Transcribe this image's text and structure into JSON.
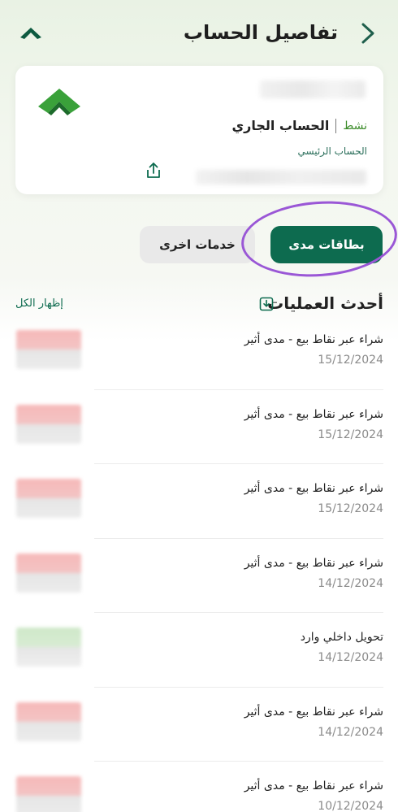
{
  "header": {
    "title": "تفاصيل الحساب",
    "back_icon": "chevron-right-icon",
    "brand_icon": "bank-logo-icon"
  },
  "account": {
    "type": "الحساب الجاري",
    "status": "نشط",
    "subtitle": "الحساب الرئيسي",
    "share_icon": "share-icon"
  },
  "actions": {
    "mada_cards": "بطاقات مدى",
    "other_services": "خدمات اخرى"
  },
  "transactions_section": {
    "title": "أحدث العمليات",
    "show_all": "إظهار الكل",
    "download_icon": "download-icon"
  },
  "transactions": [
    {
      "description": "شراء عبر نقاط بيع - مدى أثير",
      "date": "15/12/2024",
      "direction": "debit"
    },
    {
      "description": "شراء عبر نقاط بيع - مدى أثير",
      "date": "15/12/2024",
      "direction": "debit"
    },
    {
      "description": "شراء عبر نقاط بيع - مدى أثير",
      "date": "15/12/2024",
      "direction": "debit"
    },
    {
      "description": "شراء عبر نقاط بيع - مدى أثير",
      "date": "14/12/2024",
      "direction": "debit"
    },
    {
      "description": "تحويل داخلي وارد",
      "date": "14/12/2024",
      "direction": "credit"
    },
    {
      "description": "شراء عبر نقاط بيع - مدى أثير",
      "date": "14/12/2024",
      "direction": "debit"
    },
    {
      "description": "شراء عبر نقاط بيع - مدى أثير",
      "date": "10/12/2024",
      "direction": "debit"
    }
  ],
  "colors": {
    "primary": "#0d6b4f",
    "status_green": "#3c8c2a",
    "highlight": "#9a57d6",
    "debit": "#f3c4c4",
    "credit": "#cfe8c9"
  }
}
